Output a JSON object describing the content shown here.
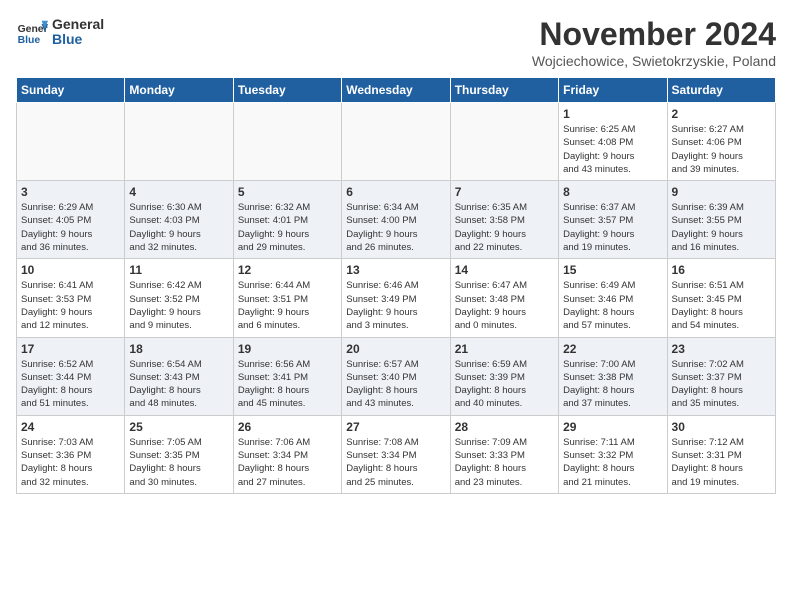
{
  "logo": {
    "general": "General",
    "blue": "Blue"
  },
  "title": "November 2024",
  "location": "Wojciechowice, Swietokrzyskie, Poland",
  "days_of_week": [
    "Sunday",
    "Monday",
    "Tuesday",
    "Wednesday",
    "Thursday",
    "Friday",
    "Saturday"
  ],
  "weeks": [
    {
      "shaded": false,
      "days": [
        {
          "num": "",
          "info": ""
        },
        {
          "num": "",
          "info": ""
        },
        {
          "num": "",
          "info": ""
        },
        {
          "num": "",
          "info": ""
        },
        {
          "num": "",
          "info": ""
        },
        {
          "num": "1",
          "info": "Sunrise: 6:25 AM\nSunset: 4:08 PM\nDaylight: 9 hours\nand 43 minutes."
        },
        {
          "num": "2",
          "info": "Sunrise: 6:27 AM\nSunset: 4:06 PM\nDaylight: 9 hours\nand 39 minutes."
        }
      ]
    },
    {
      "shaded": true,
      "days": [
        {
          "num": "3",
          "info": "Sunrise: 6:29 AM\nSunset: 4:05 PM\nDaylight: 9 hours\nand 36 minutes."
        },
        {
          "num": "4",
          "info": "Sunrise: 6:30 AM\nSunset: 4:03 PM\nDaylight: 9 hours\nand 32 minutes."
        },
        {
          "num": "5",
          "info": "Sunrise: 6:32 AM\nSunset: 4:01 PM\nDaylight: 9 hours\nand 29 minutes."
        },
        {
          "num": "6",
          "info": "Sunrise: 6:34 AM\nSunset: 4:00 PM\nDaylight: 9 hours\nand 26 minutes."
        },
        {
          "num": "7",
          "info": "Sunrise: 6:35 AM\nSunset: 3:58 PM\nDaylight: 9 hours\nand 22 minutes."
        },
        {
          "num": "8",
          "info": "Sunrise: 6:37 AM\nSunset: 3:57 PM\nDaylight: 9 hours\nand 19 minutes."
        },
        {
          "num": "9",
          "info": "Sunrise: 6:39 AM\nSunset: 3:55 PM\nDaylight: 9 hours\nand 16 minutes."
        }
      ]
    },
    {
      "shaded": false,
      "days": [
        {
          "num": "10",
          "info": "Sunrise: 6:41 AM\nSunset: 3:53 PM\nDaylight: 9 hours\nand 12 minutes."
        },
        {
          "num": "11",
          "info": "Sunrise: 6:42 AM\nSunset: 3:52 PM\nDaylight: 9 hours\nand 9 minutes."
        },
        {
          "num": "12",
          "info": "Sunrise: 6:44 AM\nSunset: 3:51 PM\nDaylight: 9 hours\nand 6 minutes."
        },
        {
          "num": "13",
          "info": "Sunrise: 6:46 AM\nSunset: 3:49 PM\nDaylight: 9 hours\nand 3 minutes."
        },
        {
          "num": "14",
          "info": "Sunrise: 6:47 AM\nSunset: 3:48 PM\nDaylight: 9 hours\nand 0 minutes."
        },
        {
          "num": "15",
          "info": "Sunrise: 6:49 AM\nSunset: 3:46 PM\nDaylight: 8 hours\nand 57 minutes."
        },
        {
          "num": "16",
          "info": "Sunrise: 6:51 AM\nSunset: 3:45 PM\nDaylight: 8 hours\nand 54 minutes."
        }
      ]
    },
    {
      "shaded": true,
      "days": [
        {
          "num": "17",
          "info": "Sunrise: 6:52 AM\nSunset: 3:44 PM\nDaylight: 8 hours\nand 51 minutes."
        },
        {
          "num": "18",
          "info": "Sunrise: 6:54 AM\nSunset: 3:43 PM\nDaylight: 8 hours\nand 48 minutes."
        },
        {
          "num": "19",
          "info": "Sunrise: 6:56 AM\nSunset: 3:41 PM\nDaylight: 8 hours\nand 45 minutes."
        },
        {
          "num": "20",
          "info": "Sunrise: 6:57 AM\nSunset: 3:40 PM\nDaylight: 8 hours\nand 43 minutes."
        },
        {
          "num": "21",
          "info": "Sunrise: 6:59 AM\nSunset: 3:39 PM\nDaylight: 8 hours\nand 40 minutes."
        },
        {
          "num": "22",
          "info": "Sunrise: 7:00 AM\nSunset: 3:38 PM\nDaylight: 8 hours\nand 37 minutes."
        },
        {
          "num": "23",
          "info": "Sunrise: 7:02 AM\nSunset: 3:37 PM\nDaylight: 8 hours\nand 35 minutes."
        }
      ]
    },
    {
      "shaded": false,
      "days": [
        {
          "num": "24",
          "info": "Sunrise: 7:03 AM\nSunset: 3:36 PM\nDaylight: 8 hours\nand 32 minutes."
        },
        {
          "num": "25",
          "info": "Sunrise: 7:05 AM\nSunset: 3:35 PM\nDaylight: 8 hours\nand 30 minutes."
        },
        {
          "num": "26",
          "info": "Sunrise: 7:06 AM\nSunset: 3:34 PM\nDaylight: 8 hours\nand 27 minutes."
        },
        {
          "num": "27",
          "info": "Sunrise: 7:08 AM\nSunset: 3:34 PM\nDaylight: 8 hours\nand 25 minutes."
        },
        {
          "num": "28",
          "info": "Sunrise: 7:09 AM\nSunset: 3:33 PM\nDaylight: 8 hours\nand 23 minutes."
        },
        {
          "num": "29",
          "info": "Sunrise: 7:11 AM\nSunset: 3:32 PM\nDaylight: 8 hours\nand 21 minutes."
        },
        {
          "num": "30",
          "info": "Sunrise: 7:12 AM\nSunset: 3:31 PM\nDaylight: 8 hours\nand 19 minutes."
        }
      ]
    }
  ]
}
